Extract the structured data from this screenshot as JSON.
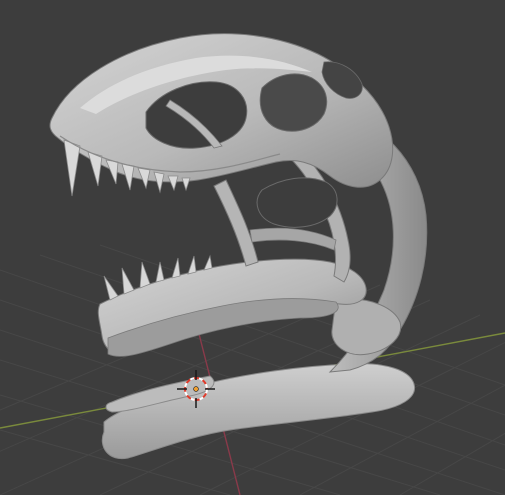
{
  "viewport": {
    "background": "#3d3d3d",
    "grid_color": "#474747",
    "x_axis_color": "#7a8a3c",
    "y_axis_color": "#8a3a4a",
    "model_light": "#c9c9c9",
    "model_mid": "#a8a8a8",
    "model_dark": "#6e6e6e",
    "cursor_colors": [
      "#e03a2a",
      "#ffffff"
    ],
    "object": "skull-model",
    "icons": [
      "3d-cursor-icon"
    ]
  }
}
